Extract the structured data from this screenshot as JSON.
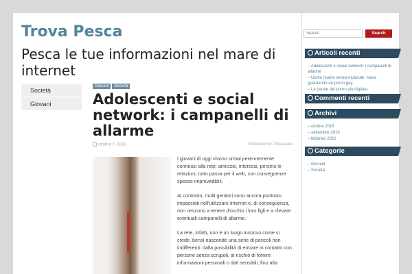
{
  "site": {
    "title": "Trova Pesca",
    "tagline": "Pesca le tue informazioni nel mare di internet"
  },
  "nav": [
    "Società",
    "Giovani"
  ],
  "post": {
    "tags": [
      "Giovani",
      "Società"
    ],
    "title": "Adolescenti e social network: i campanelli di allarme",
    "date": "ottobre 7, 2016",
    "byline": "Published by: Pescatore",
    "paragraphs": [
      "I giovani di oggi vivono ormai perennemente connessi alla rete: amicizie, interessi, persino le relazioni, tutto passa per il web, con conseguenze spesso imprevedibili.",
      "Al contrario, molti genitori sono ancora piuttosto impacciati nell'utilizzare Internet e, di conseguenza, non riescono a tenere d'occhio i loro figli e a rilevare eventuali campanelli di allarme.",
      "La rete, infatti, non è un luogo innocuo come si crede, bensì nasconde una serie di pericoli non indifferenti: dalla possibilità di entrare in contatto con persone senza scrupoli, al rischio di fornire informazioni personali o dati sensibili, fino alla"
    ]
  },
  "sidebar": {
    "search_placeholder": "Search",
    "search_button": "Search",
    "recent_title": "Articoli recenti",
    "recent": [
      "Adolescenti e social network: i campanelli di allarme",
      "Uomo muore senza mutande: stava guardando un porno gay.",
      "Le parole del porno più digitate"
    ],
    "comments_title": "Commenti recenti",
    "archive_title": "Archivi",
    "archive": [
      "ottobre 2016",
      "settembre 2016",
      "febbraio 2016"
    ],
    "categories_title": "Categorie",
    "categories": [
      "Giovani",
      "Società"
    ]
  }
}
